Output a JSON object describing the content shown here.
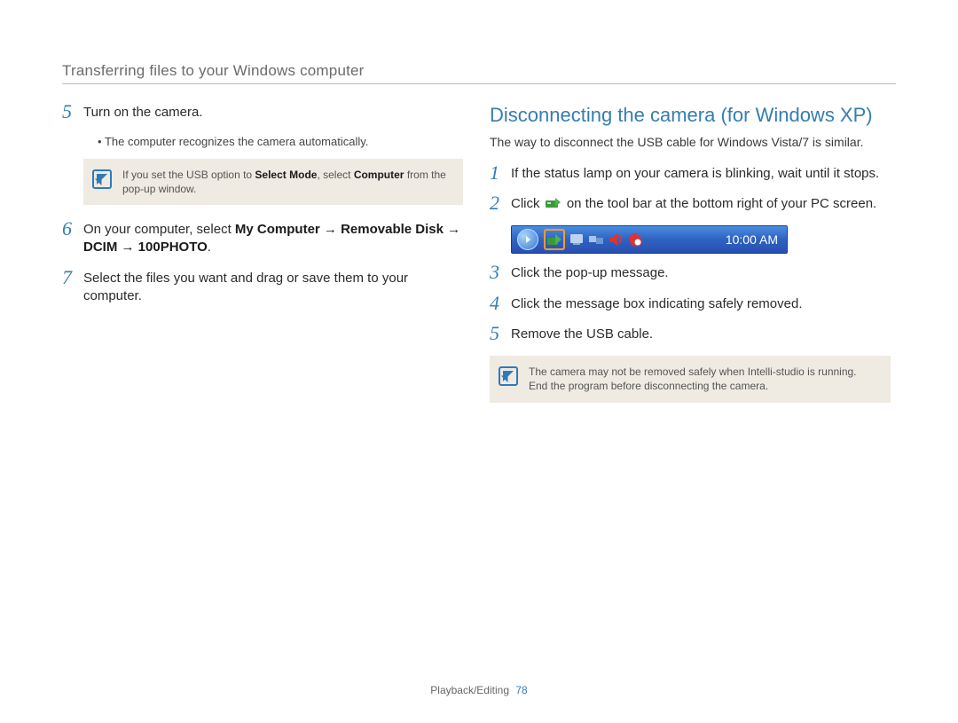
{
  "header": {
    "title": "Transferring files to your Windows computer"
  },
  "left": {
    "step5": {
      "num": "5",
      "text": "Turn on the camera.",
      "bullet": "The computer recognizes the camera automatically."
    },
    "note1": {
      "pre": "If you set the USB option to ",
      "b1": "Select Mode",
      "mid": ", select ",
      "b2": "Computer",
      "post": " from the pop-up window."
    },
    "step6": {
      "num": "6",
      "pre": "On your computer, select ",
      "bold": "My Computer → Removable Disk → DCIM → 100PHOTO",
      "post": "."
    },
    "step7": {
      "num": "7",
      "text": "Select the files you want and drag or save them to your computer."
    }
  },
  "right": {
    "heading": "Disconnecting the camera (for Windows XP)",
    "lead": "The way to disconnect the USB cable for Windows Vista/7 is similar.",
    "step1": {
      "num": "1",
      "text": "If the status lamp on your camera is blinking, wait until it stops."
    },
    "step2": {
      "num": "2",
      "pre": "Click ",
      "post": " on the tool bar at the bottom right of your PC screen."
    },
    "step3": {
      "num": "3",
      "text": "Click the pop-up message."
    },
    "step4": {
      "num": "4",
      "text": "Click the message box indicating safely removed."
    },
    "step5": {
      "num": "5",
      "text": "Remove the USB cable."
    },
    "taskbar_clock": "10:00 AM",
    "note2": "The camera may not be removed safely when Intelli-studio is running. End the program before disconnecting the camera."
  },
  "footer": {
    "section": "Playback/Editing",
    "page": "78"
  }
}
